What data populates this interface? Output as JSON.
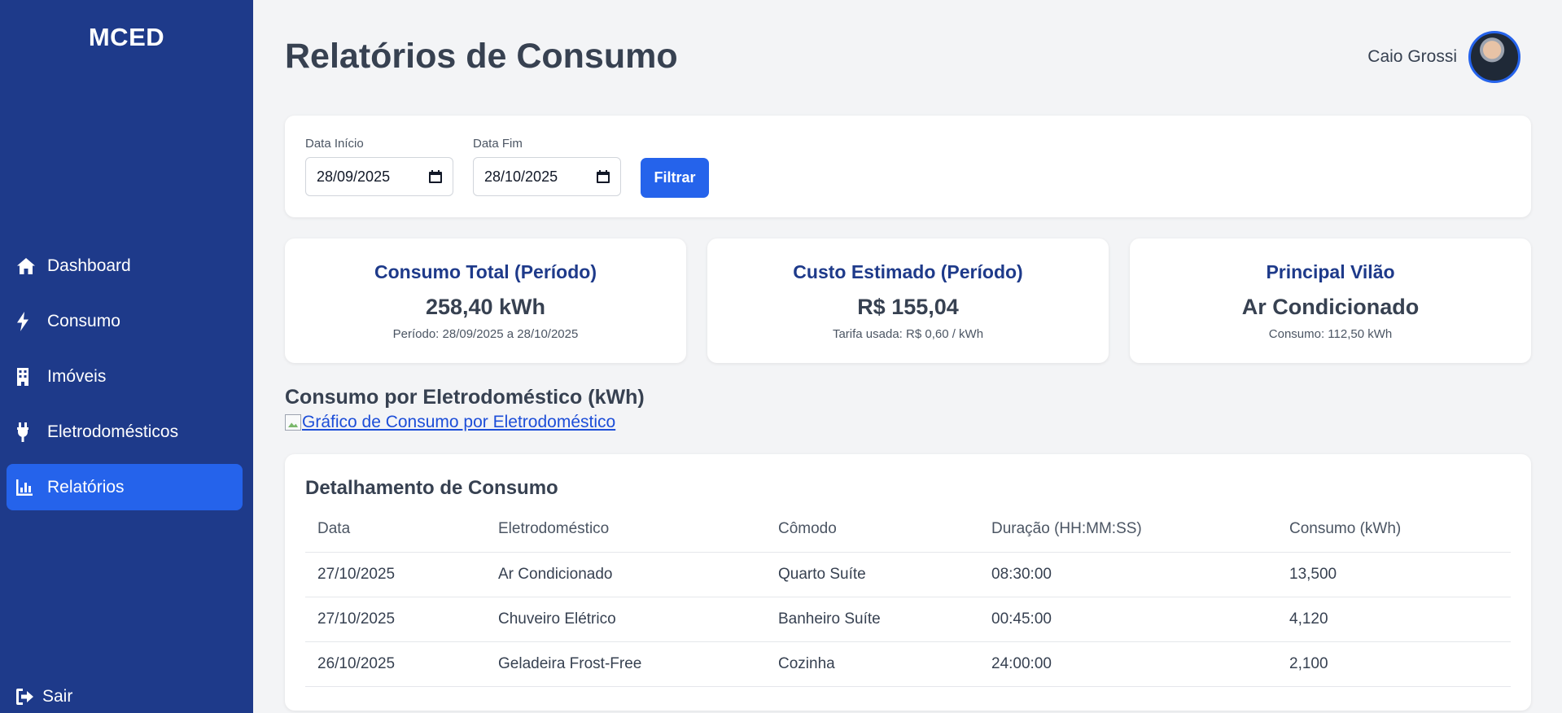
{
  "sidebar": {
    "brand": "MCED",
    "items": [
      {
        "label": "Dashboard",
        "icon": "home-icon"
      },
      {
        "label": "Consumo",
        "icon": "bolt-icon"
      },
      {
        "label": "Imóveis",
        "icon": "building-icon"
      },
      {
        "label": "Eletrodomésticos",
        "icon": "plug-icon"
      },
      {
        "label": "Relatórios",
        "icon": "chart-icon",
        "active": true
      }
    ],
    "logout_label": "Sair"
  },
  "header": {
    "title": "Relatórios de Consumo",
    "user_name": "Caio Grossi"
  },
  "filter": {
    "start_label": "Data Início",
    "start_value": "28/09/2025",
    "end_label": "Data Fim",
    "end_value": "28/10/2025",
    "button_label": "Filtrar"
  },
  "stats": [
    {
      "title": "Consumo Total (Período)",
      "value": "258,40 kWh",
      "sub": "Período: 28/09/2025 a 28/10/2025"
    },
    {
      "title": "Custo Estimado (Período)",
      "value": "R$ 155,04",
      "sub": "Tarifa usada: R$ 0,60 / kWh"
    },
    {
      "title": "Principal Vilão",
      "value": "Ar Condicionado",
      "sub": "Consumo: 112,50 kWh"
    }
  ],
  "chart_section": {
    "heading": "Consumo por Eletrodoméstico (kWh)",
    "image_alt": "Gráfico de Consumo por Eletrodoméstico"
  },
  "table": {
    "title": "Detalhamento de Consumo",
    "columns": [
      "Data",
      "Eletrodoméstico",
      "Cômodo",
      "Duração (HH:MM:SS)",
      "Consumo (kWh)"
    ],
    "rows": [
      [
        "27/10/2025",
        "Ar Condicionado",
        "Quarto Suíte",
        "08:30:00",
        "13,500"
      ],
      [
        "27/10/2025",
        "Chuveiro Elétrico",
        "Banheiro Suíte",
        "00:45:00",
        "4,120"
      ],
      [
        "26/10/2025",
        "Geladeira Frost-Free",
        "Cozinha",
        "24:00:00",
        "2,100"
      ]
    ]
  },
  "colors": {
    "sidebar_bg": "#1e3a8a",
    "accent": "#2563eb",
    "page_bg": "#f3f4f6"
  }
}
